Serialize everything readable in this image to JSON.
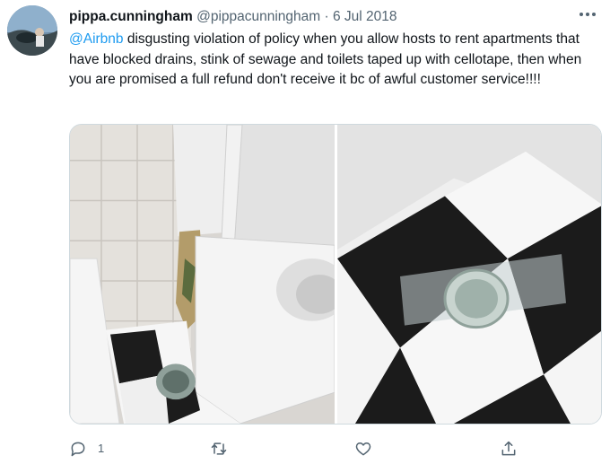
{
  "tweet": {
    "display_name": "pippa.cunningham",
    "handle": "@pippacunningham",
    "separator": "·",
    "date": "6 Jul 2018",
    "mention": "@Airbnb",
    "text": " disgusting violation of policy when you allow hosts to rent apartments that have blocked drains, stink of sewage and toilets taped up with cellotape, then when you are promised a full refund don't receive it bc of awful customer service!!!!",
    "more_icon": "more-icon",
    "reply_count": "1"
  },
  "media": {
    "photo_left": "bathroom-toilet-photo",
    "photo_right": "taped-drain-photo"
  },
  "colors": {
    "accent": "#1d9bf0",
    "muted": "#536471",
    "text": "#0f1419",
    "border": "#cfd9de"
  }
}
